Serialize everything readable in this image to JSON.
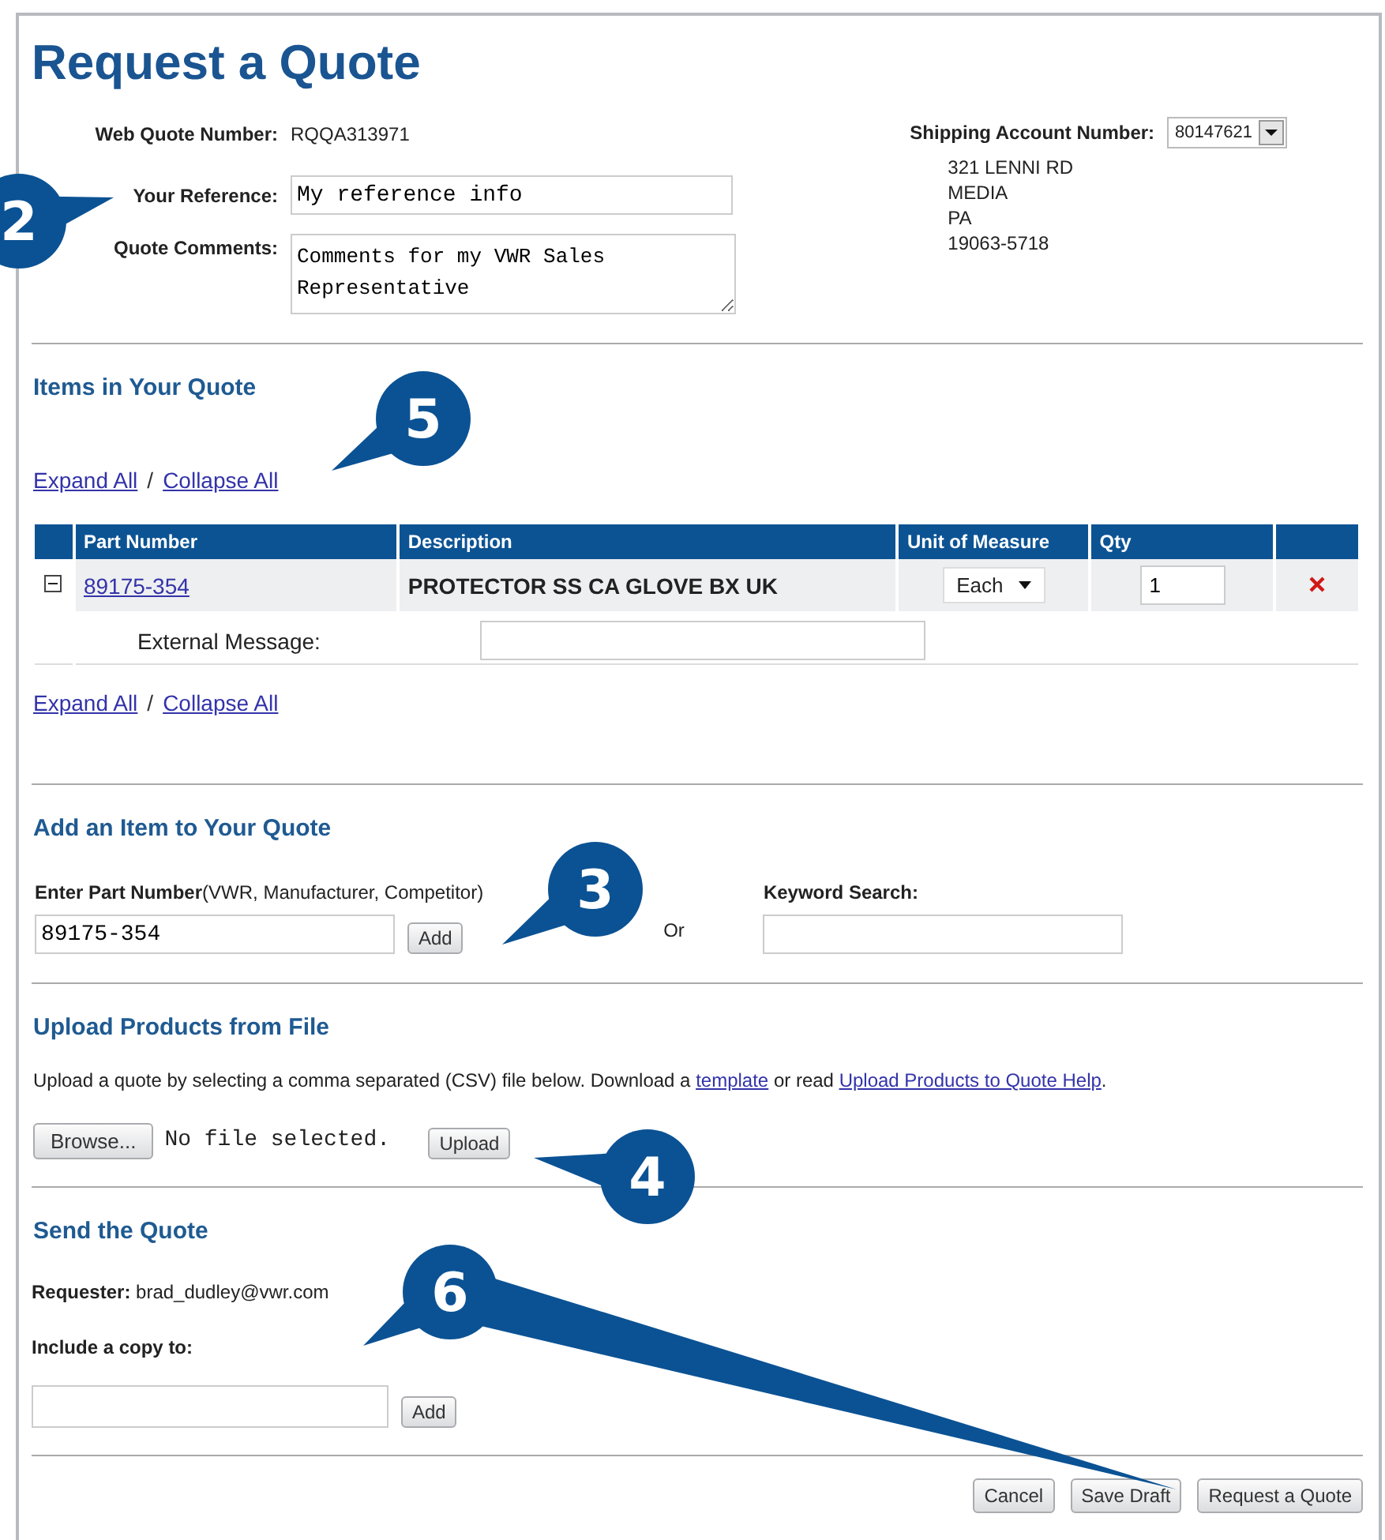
{
  "title": "Request a Quote",
  "quote_info": {
    "number_label": "Web Quote Number:",
    "number": "RQQA313971",
    "reference_label": "Your Reference:",
    "reference_value": "My reference info",
    "comments_label": "Quote Comments:",
    "comments_value": "Comments for my VWR Sales Representative"
  },
  "shipping": {
    "label": "Shipping Account Number:",
    "account": "80147621",
    "address": [
      "321 LENNI RD",
      "MEDIA",
      "PA",
      "19063-5718"
    ]
  },
  "items": {
    "heading": "Items in Your Quote",
    "links_top": {
      "expand_all": "Expand All",
      "separator": "/",
      "collapse_all": "Collapse All"
    },
    "links_bottom": {
      "expand_all": "Expand All",
      "separator": "/",
      "collapse_all": "Collapse All"
    },
    "columns": [
      "Part Number",
      "Description",
      "Unit of Measure",
      "Qty"
    ],
    "rows": [
      {
        "expanded": true,
        "part_number": "89175-354",
        "description": "PROTECTOR SS CA GLOVE BX UK",
        "unit": "Each",
        "qty": "1",
        "external_message_label": "External Message:"
      }
    ]
  },
  "add_item": {
    "heading": "Add an Item to Your Quote",
    "part_label": "**Enter Part Number**(VWR, Manufacturer, Competitor)",
    "part_value": "89175-354",
    "add_button": "Add",
    "or": "Or",
    "keyword_label": "Keyword Search:"
  },
  "upload": {
    "heading": "Upload Products from File",
    "text_before": "Upload a quote by selecting a comma separated (CSV) file below. Download a ",
    "template_link": "template",
    "text_middle": " or read ",
    "help_link": "Upload Products to Quote Help",
    "text_after": ".",
    "browse_button": "Browse...",
    "file_status": "No file selected.",
    "upload_button": "Upload"
  },
  "send": {
    "heading": "Send the Quote",
    "requester": "**Requester:** brad_dudley@vwr.com",
    "copy_label": "Include a copy to:",
    "add_button": "Add"
  },
  "actions": [
    "Cancel",
    "Save Draft",
    "Request a Quote"
  ],
  "callouts": [
    {
      "label": "2"
    },
    {
      "label": "5"
    },
    {
      "label": "3"
    },
    {
      "label": "4"
    },
    {
      "label": "6"
    }
  ]
}
